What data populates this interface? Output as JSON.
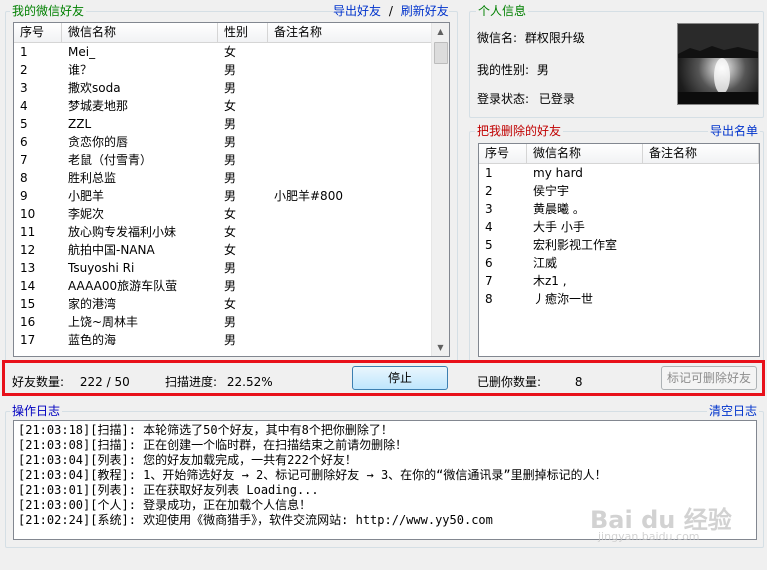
{
  "friends_panel": {
    "title": "我的微信好友",
    "export_link": "导出好友",
    "sep": "/",
    "refresh_link": "刷新好友",
    "columns": [
      "序号",
      "微信名称",
      "性别",
      "备注名称"
    ],
    "rows": [
      [
        "1",
        "Mei_",
        "女",
        ""
      ],
      [
        "2",
        "谁？",
        "男",
        ""
      ],
      [
        "3",
        "撒欢soda",
        "男",
        ""
      ],
      [
        "4",
        "梦城麦地那",
        "女",
        ""
      ],
      [
        "5",
        "ZZL",
        "男",
        ""
      ],
      [
        "6",
        "贪恋你的唇",
        "男",
        ""
      ],
      [
        "7",
        "老鼠（付雪青）",
        "男",
        ""
      ],
      [
        "8",
        "胜利总监",
        "男",
        ""
      ],
      [
        "9",
        "小肥羊",
        "男",
        "小肥羊#800"
      ],
      [
        "10",
        "李妮次",
        "女",
        ""
      ],
      [
        "11",
        "放心购专发福利小妹",
        "女",
        ""
      ],
      [
        "12",
        "航拍中国-NANA",
        "女",
        ""
      ],
      [
        "13",
        "Tsuyoshi Ri",
        "男",
        ""
      ],
      [
        "14",
        "AAAA00旅游车队萤",
        "男",
        ""
      ],
      [
        "15",
        "家的港湾",
        "女",
        ""
      ],
      [
        "16",
        "上饶~周林丰",
        "男",
        ""
      ],
      [
        "17",
        "蓝色的海",
        "男",
        ""
      ]
    ]
  },
  "status_bar": {
    "friend_count_label": "好友数量:",
    "friend_count_value": "222 / 50",
    "scan_progress_label": "扫描进度:",
    "scan_progress_value": "22.52%",
    "stop_button": "停止",
    "deleted_count_label": "已删你数量:",
    "deleted_count_value": "8",
    "mark_button": "标记可删除好友"
  },
  "profile": {
    "title": "个人信息",
    "wechat_name_label": "微信名:",
    "wechat_name_value": "群权限升级",
    "gender_label": "我的性别:",
    "gender_value": "男",
    "login_label": "登录状态:",
    "login_value": "已登录"
  },
  "deleted_panel": {
    "title": "把我删除的好友",
    "export_link": "导出名单",
    "columns": [
      "序号",
      "微信名称",
      "备注名称"
    ],
    "rows": [
      [
        "1",
        "my hard",
        ""
      ],
      [
        "2",
        "侯宁宇",
        ""
      ],
      [
        "3",
        "黄晨曦 。",
        ""
      ],
      [
        "4",
        "大手 小手",
        ""
      ],
      [
        "5",
        "宏利影视工作室",
        ""
      ],
      [
        "6",
        "江威",
        ""
      ],
      [
        "7",
        "木z1 ,",
        ""
      ],
      [
        "8",
        "丿癒沵一世",
        ""
      ]
    ]
  },
  "log_panel": {
    "title": "操作日志",
    "clear_link": "清空日志",
    "lines": [
      "[21:03:18][扫描]: 本轮筛选了50个好友，其中有8个把你删除了！",
      "[21:03:08][扫描]: 正在创建一个临时群，在扫描结束之前请勿删除！",
      "[21:03:04][列表]: 您的好友加载完成，一共有222个好友！",
      "[21:03:04][教程]: 1、开始筛选好友 → 2、标记可删除好友 → 3、在你的“微信通讯录”里删掉标记的人！",
      "[21:03:01][列表]: 正在获取好友列表 Loading...",
      "[21:03:00][个人]: 登录成功，正在加载个人信息！",
      "[21:02:24][系统]: 欢迎使用《微商猎手》，软件交流网站: http://www.yy50.com"
    ]
  },
  "watermark": {
    "brand": "Bai du 经验",
    "url": "jingyan.baidu.com"
  }
}
